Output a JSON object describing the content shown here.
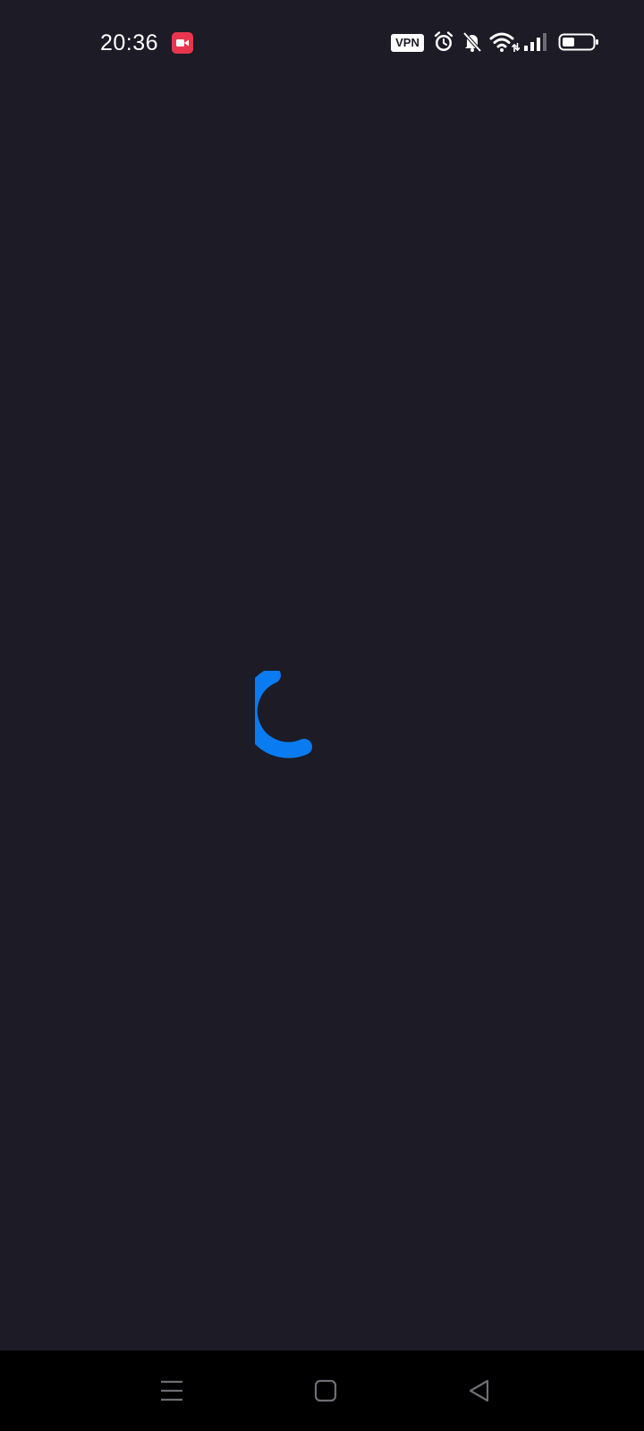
{
  "status_bar": {
    "time": "20:36",
    "vpn_label": "VPN",
    "icons": [
      "screen-record-icon",
      "alarm-icon",
      "notifications-muted-icon",
      "wifi-icon",
      "signal-icon",
      "battery-icon"
    ]
  },
  "content": {
    "state": "loading",
    "spinner_color": "#0a7bf0",
    "background_color": "#1c1b26"
  },
  "nav_bar": {
    "buttons": [
      "menu-icon",
      "home-icon",
      "back-icon"
    ]
  }
}
